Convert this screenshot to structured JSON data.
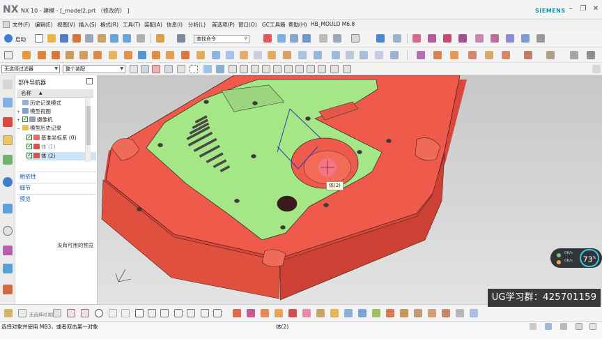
{
  "window": {
    "logo": "NX",
    "title": "NX 10 - 建模 - [_model2.prt （修改的） ]",
    "brand": "SIEMENS",
    "minimize": "–",
    "restore": "❐",
    "close": "✕"
  },
  "menu": {
    "items": [
      "文件(F)",
      "编辑(E)",
      "视图(V)",
      "插入(S)",
      "格式(R)",
      "工具(T)",
      "装配(A)",
      "信息(I)",
      "分析(L)",
      "首选项(P)",
      "窗口(O)",
      "GC工具箱",
      "帮助(H)",
      "HB_MOULD M6.8"
    ]
  },
  "toolbar": {
    "start_label": "启动",
    "search_placeholder": "查找命令"
  },
  "selection_bar": {
    "filter_value": "无选择过滤器",
    "scope_value": "整个装配"
  },
  "navigator": {
    "title": "部件导航器",
    "column_header": "名称",
    "sort_arrow": "▲",
    "tree": [
      {
        "label": "历史记录模式",
        "level": 0,
        "toggle": "",
        "check": false
      },
      {
        "label": "模型视图",
        "level": 0,
        "toggle": "+",
        "check": false
      },
      {
        "label": "摄像机",
        "level": 0,
        "toggle": "+",
        "check": true
      },
      {
        "label": "模型历史记录",
        "level": 0,
        "toggle": "−",
        "check": false
      },
      {
        "label": "基准坐标系 (0)",
        "level": 1,
        "toggle": "",
        "check": true
      },
      {
        "label": "体 (1)",
        "level": 1,
        "toggle": "",
        "check": true,
        "muted": true
      },
      {
        "label": "体 (2)",
        "level": 1,
        "toggle": "",
        "check": true,
        "selected": true
      }
    ],
    "sections": {
      "dependencies": "相依性",
      "details": "细节",
      "preview": "预览"
    },
    "empty_preview": "没有可用的预览"
  },
  "viewport": {
    "tooltip": "体(2)",
    "colors": {
      "body_red": "#ef5a4a",
      "plate_green": "#a5e686",
      "edge_dark": "#3a2020"
    }
  },
  "overlay": {
    "group_badge": "UG学习群：425701159",
    "network_percent": "73",
    "percent_sign": "%",
    "upload_rate": "0K/s",
    "download_rate": "0K/s"
  },
  "bottom": {
    "snap_label": "无选择过滤器"
  },
  "status": {
    "message": "选择对象并使用 MB3，或者双击某一对象",
    "selection": "体(2)"
  }
}
